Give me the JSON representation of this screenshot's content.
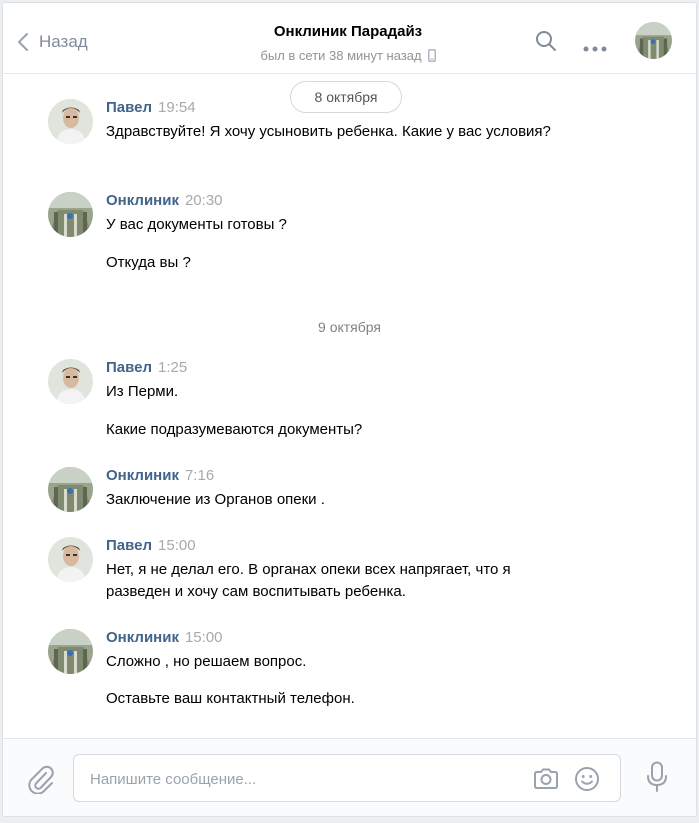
{
  "header": {
    "back_label": "Назад",
    "title": "Онклиник Парадайз",
    "status": "был в сети 38 минут назад"
  },
  "dates": {
    "first": "8 октября",
    "second": "9 октября"
  },
  "messages": [
    {
      "author": "Павел",
      "time": "19:54",
      "avatar": "pavel",
      "texts": [
        "Здравствуйте! Я хочу усыновить ребенка. Какие у вас условия?"
      ]
    },
    {
      "author": "Онклиник",
      "time": "20:30",
      "avatar": "onclinic",
      "texts": [
        "У вас документы готовы ?",
        "Откуда вы ?"
      ]
    },
    {
      "author": "Павел",
      "time": "1:25",
      "avatar": "pavel",
      "texts": [
        "Из Перми.",
        "Какие подразумеваются документы?"
      ]
    },
    {
      "author": "Онклиник",
      "time": "7:16",
      "avatar": "onclinic",
      "texts": [
        "Заключение из Органов опеки ."
      ]
    },
    {
      "author": "Павел",
      "time": "15:00",
      "avatar": "pavel",
      "texts": [
        "Нет, я не делал его. В органах опеки всех напрягает, что я разведен и хочу сам воспитывать ребенка."
      ]
    },
    {
      "author": "Онклиник",
      "time": "15:00",
      "avatar": "onclinic",
      "texts": [
        "Сложно , но решаем вопрос.",
        "Оставьте ваш контактный телефон."
      ]
    }
  ],
  "composer": {
    "placeholder": "Напишите сообщение..."
  },
  "icons": {
    "back": "chevron-left-icon",
    "search": "search-icon",
    "more": "more-dots-icon",
    "phone": "mobile-phone-icon",
    "attach": "paperclip-icon",
    "camera": "camera-icon",
    "emoji": "smile-icon",
    "mic": "microphone-icon"
  },
  "colors": {
    "author": "#42648b",
    "accent": "#5181b8",
    "icon": "#828a99",
    "background": "#edeef0"
  }
}
